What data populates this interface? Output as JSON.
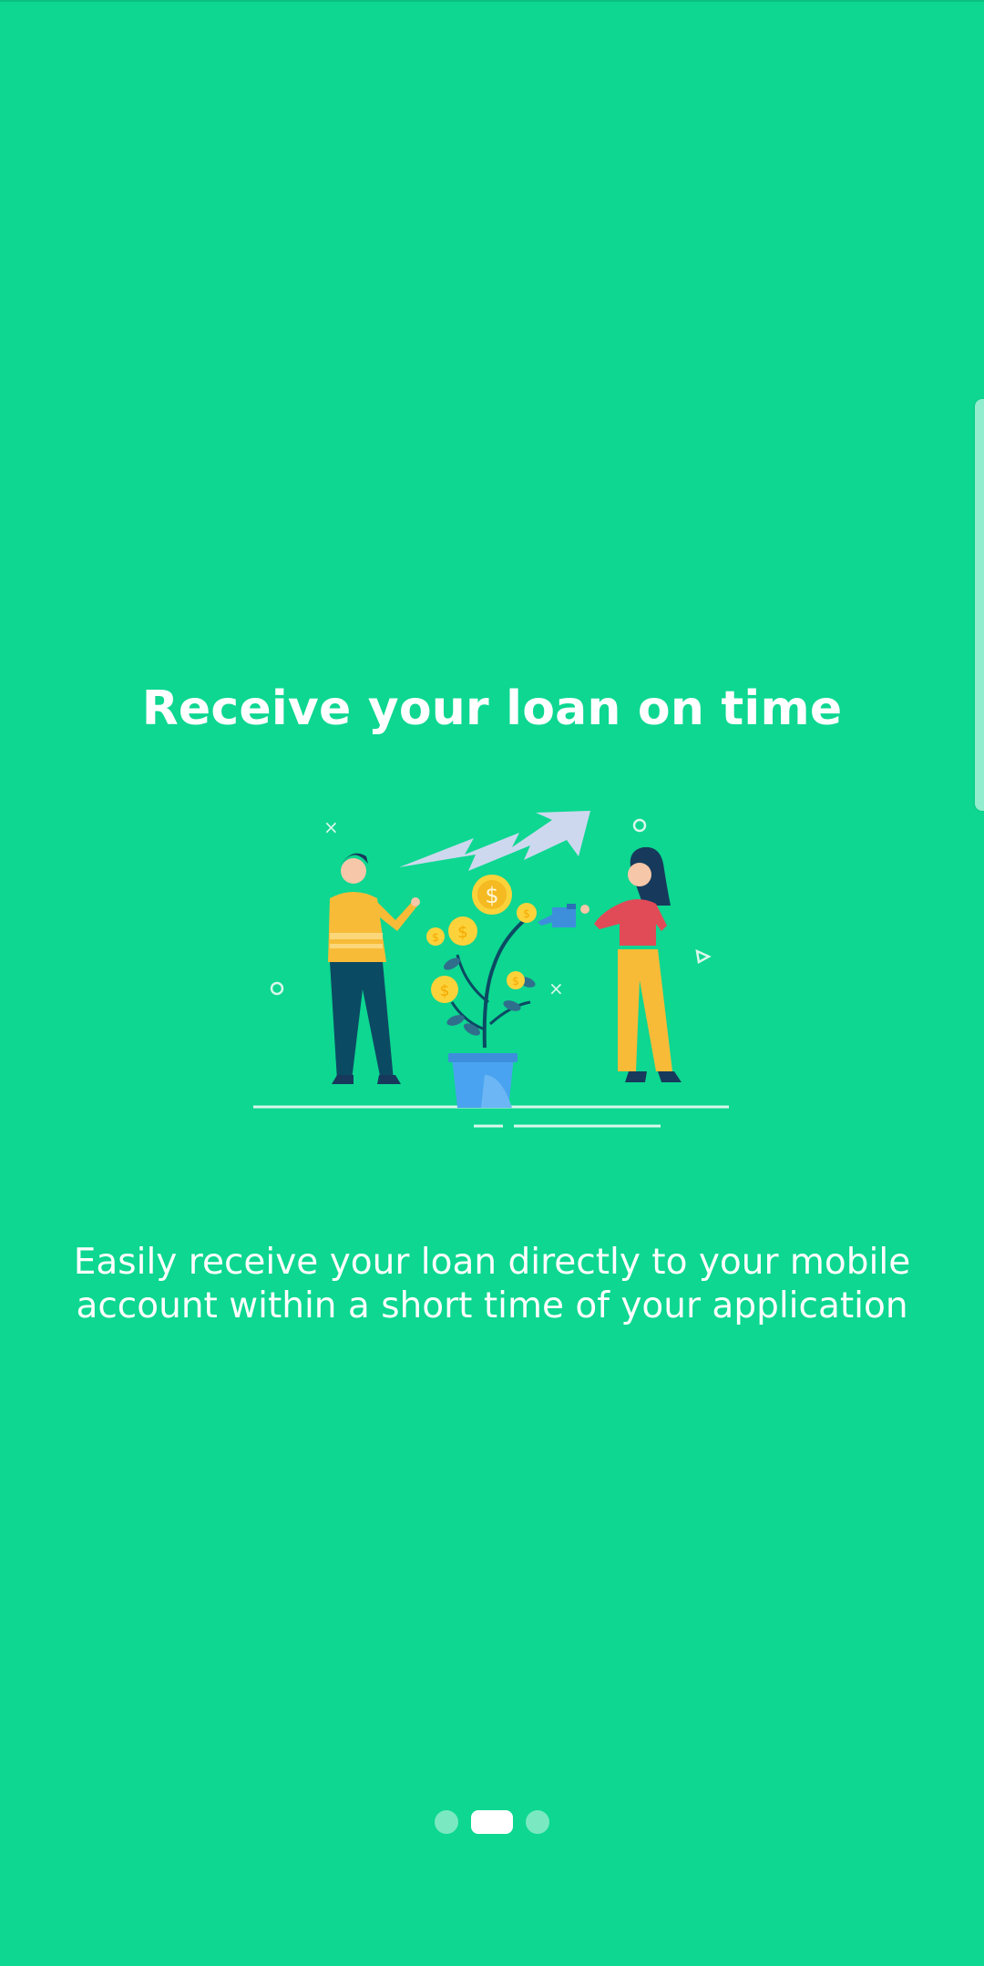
{
  "onboarding": {
    "title": "Receive your loan on time",
    "description": "Easily receive your loan directly to your mobile account within a short time of your application",
    "page_indicator": {
      "total": 3,
      "active_index": 1
    }
  },
  "colors": {
    "background": "#0dd791",
    "text": "#ffffff",
    "indicator_active": "#ffffff",
    "indicator_inactive": "rgba(255,255,255,0.45)"
  },
  "illustration": {
    "icon": "loan-growth-illustration-icon"
  }
}
